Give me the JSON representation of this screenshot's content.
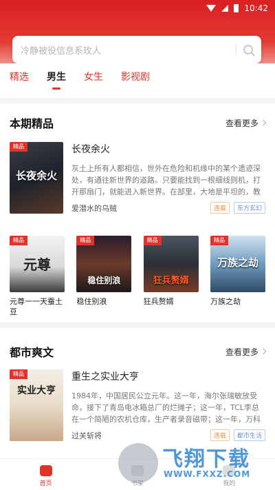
{
  "status": {
    "time": "10:42"
  },
  "search": {
    "placeholder": "冷静被役信息系玫人"
  },
  "tabs": [
    {
      "label": "精选"
    },
    {
      "label": "男生"
    },
    {
      "label": "女生"
    },
    {
      "label": "影视剧"
    }
  ],
  "section1": {
    "title": "本期精品",
    "more": "查看更多",
    "featured": {
      "title": "长夜余火",
      "cover_text": "长夜余火",
      "description": "灰土上所有人都相信，世外在危险和机缘中的某个遗迹深处，有通往新世界的道路。只要能找到一根细线则机，打开那扇门，就能进入新世界。在部里，大地是平坦的，教徒...",
      "author": "爱潜水的乌贼",
      "tags": [
        "连载",
        "东方玄幻"
      ]
    },
    "grid": [
      {
        "name": "元尊一一天蚕土豆",
        "cover_text": "元尊"
      },
      {
        "name": "稳住别浪",
        "cover_text": "稳住别浪"
      },
      {
        "name": "狂兵赘婿",
        "cover_text": "狂兵赘婿"
      },
      {
        "name": "万族之劫",
        "cover_text": "万族之劫"
      }
    ]
  },
  "section2": {
    "title": "都市爽文",
    "more": "查看更多",
    "featured": {
      "title": "重生之实业大亨",
      "cover_text": "实业大亨",
      "description": "1984年，中国居民公立元年。这一年，海尔张瑞敏放受命，接下了青岛电冰箱总厂的烂摊子；这一年，TCL李总在一个简陋的农机仓库，生产者录音磁带；这一年，万科王石做着倒卖...",
      "author": "过关斩将",
      "tags": [
        "连载",
        "都市生活"
      ]
    }
  },
  "nav": [
    {
      "label": "首页",
      "active": true
    },
    {
      "label": "书架",
      "active": false
    },
    {
      "label": "我的",
      "active": false
    }
  ],
  "watermark": {
    "title": "飞翔下载",
    "url": "WWW.FXXZ.COM"
  },
  "colors": {
    "brand": "#e0332b",
    "header_top": "#d91f22"
  }
}
